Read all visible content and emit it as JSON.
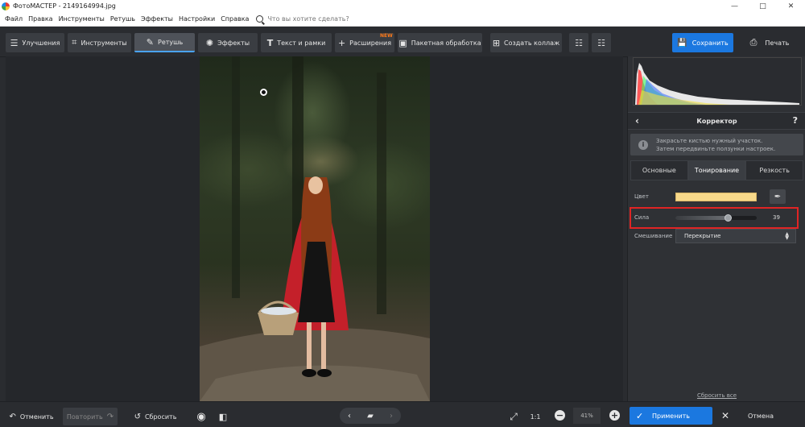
{
  "window": {
    "title": "ФотоМАСТЕР - 2149164994.jpg",
    "controls": {
      "minimize": "—",
      "maximize": "□",
      "close": "✕"
    }
  },
  "menu": {
    "items": [
      "Файл",
      "Правка",
      "Инструменты",
      "Ретушь",
      "Эффекты",
      "Настройки",
      "Справка"
    ],
    "search_placeholder": "Что вы хотите сделать?"
  },
  "toolbar": {
    "tabs": [
      {
        "label": "Улучшения",
        "icon": "sliders-icon"
      },
      {
        "label": "Инструменты",
        "icon": "crop-icon"
      },
      {
        "label": "Ретушь",
        "icon": "brush-icon",
        "active": true
      },
      {
        "label": "Эффекты",
        "icon": "sparkle-icon"
      },
      {
        "label": "Текст и рамки",
        "icon": "text-icon"
      },
      {
        "label": "Расширения",
        "icon": "plus-icon",
        "badge": "NEW"
      },
      {
        "label": "Пакетная обработка",
        "icon": "image-icon"
      },
      {
        "label": "Создать коллаж",
        "icon": "collage-icon"
      }
    ],
    "save_label": "Сохранить",
    "print_label": "Печать"
  },
  "panel": {
    "title": "Корректор",
    "hint_line1": "Закрасьте кистью нужный участок.",
    "hint_line2": "Затем передвиньте ползунки настроек.",
    "tabs": [
      "Основные",
      "Тонирование",
      "Резкость"
    ],
    "active_tab": "Тонирование",
    "color_label": "Цвет",
    "color_value": "#f8d98a",
    "strength_label": "Сила",
    "strength_value": "39",
    "strength_fraction": 0.64,
    "blend_label": "Смешивание",
    "blend_value": "Перекрытие",
    "reset_all": "Сбросить все"
  },
  "bottom": {
    "undo": "Отменить",
    "redo": "Повторить",
    "reset": "Сбросить",
    "actual_size": "1:1",
    "zoom": "41%",
    "apply": "Применить",
    "cancel": "Отмена"
  },
  "colors": {
    "accent": "#1b78e0",
    "highlight": "#e02424",
    "new_badge": "#ff7a1a"
  }
}
